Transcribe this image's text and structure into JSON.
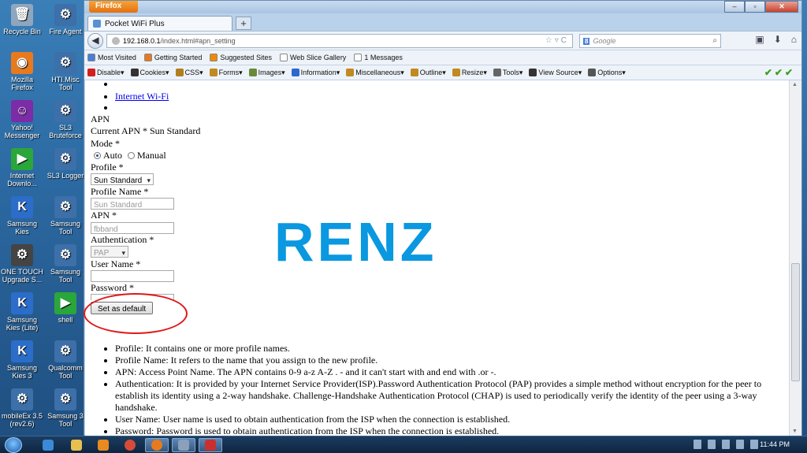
{
  "desktop": {
    "icons": [
      {
        "label": "Recycle Bin",
        "color": "#8fa6bf",
        "glyph": "🗑"
      },
      {
        "label": "Fire Agent",
        "color": "#3d6fa8",
        "glyph": "⚙"
      },
      {
        "label": "Mozilla Firefox",
        "color": "#e87a1e",
        "glyph": "◉"
      },
      {
        "label": "HTI.Misc Tool",
        "color": "#3d6fa8",
        "glyph": "⚙"
      },
      {
        "label": "Yahoo! Messenger",
        "color": "#7b2ca6",
        "glyph": "☺"
      },
      {
        "label": "SL3 Bruteforce",
        "color": "#3d6fa8",
        "glyph": "⚙"
      },
      {
        "label": "Internet Downlo...",
        "color": "#2aa63a",
        "glyph": "▶"
      },
      {
        "label": "SL3 Logger",
        "color": "#3d6fa8",
        "glyph": "⚙"
      },
      {
        "label": "Samsung Kies",
        "color": "#2b6dc8",
        "glyph": "K"
      },
      {
        "label": "Samsung Tool",
        "color": "#3d6fa8",
        "glyph": "⚙"
      },
      {
        "label": "ONE TOUCH Upgrade S...",
        "color": "#444",
        "glyph": "⚙"
      },
      {
        "label": "Samsung Tool",
        "color": "#3d6fa8",
        "glyph": "⚙"
      },
      {
        "label": "Samsung Kies (Lite)",
        "color": "#2b6dc8",
        "glyph": "K"
      },
      {
        "label": "shell",
        "color": "#2aa63a",
        "glyph": "▶"
      },
      {
        "label": "Samsung Kies 3",
        "color": "#2b6dc8",
        "glyph": "K"
      },
      {
        "label": "Qualcomm Tool",
        "color": "#3d6fa8",
        "glyph": "⚙"
      },
      {
        "label": "mobileEx 3.5 (rev2.6)",
        "color": "#3d6fa8",
        "glyph": "⚙"
      },
      {
        "label": "Samsung 3 Tool",
        "color": "#3d6fa8",
        "glyph": "⚙"
      }
    ]
  },
  "browser": {
    "app_button": "Firefox",
    "tab_title": "Pocket WiFi Plus",
    "new_tab": "+",
    "url_domain": "192.168.0.1",
    "url_path": "/index.html#apn_setting",
    "search_placeholder": "Google",
    "bookmarks": [
      {
        "label": "Most Visited",
        "color": "#4a7ed8"
      },
      {
        "label": "Getting Started",
        "color": "#e87a1e"
      },
      {
        "label": "Suggested Sites",
        "color": "#f08a00"
      },
      {
        "label": "Web Slice Gallery",
        "color": "#ffffff"
      },
      {
        "label": "1 Messages",
        "color": "#ffffff"
      }
    ],
    "devtools": [
      {
        "label": "Disable▾",
        "color": "#d02020"
      },
      {
        "label": "Cookies▾",
        "color": "#333"
      },
      {
        "label": "CSS▾",
        "color": "#b08020"
      },
      {
        "label": "Forms▾",
        "color": "#c08a20"
      },
      {
        "label": "Images▾",
        "color": "#6a8a3a"
      },
      {
        "label": "Information▾",
        "color": "#2a6ad0"
      },
      {
        "label": "Miscellaneous▾",
        "color": "#c08a20"
      },
      {
        "label": "Outline▾",
        "color": "#c08a20"
      },
      {
        "label": "Resize▾",
        "color": "#c08a20"
      },
      {
        "label": "Tools▾",
        "color": "#666"
      },
      {
        "label": "View Source▾",
        "color": "#333"
      },
      {
        "label": "Options▾",
        "color": "#555"
      }
    ]
  },
  "page": {
    "nav_link": "Internet Wi-Fi",
    "section_title": "APN",
    "current_apn": "Current APN * Sun Standard",
    "mode_label": "Mode *",
    "mode_auto": "Auto",
    "mode_manual": "Manual",
    "profile_label": "Profile *",
    "profile_value": "Sun Standard",
    "profile_name_label": "Profile Name *",
    "profile_name_value": "Sun Standard",
    "apn_label": "APN *",
    "apn_value": "fbband",
    "auth_label": "Authentication *",
    "auth_value": "PAP",
    "username_label": "User Name *",
    "password_label": "Password *",
    "set_default_button": "Set as default",
    "help": [
      "Profile: It contains one or more profile names.",
      "Profile Name: It refers to the name that you assign to the new profile.",
      "APN: Access Point Name. The APN contains 0-9 a-z A-Z . - and it can't start with and end with .or -.",
      "Authentication: It is provided by your Internet Service Provider(ISP).Password Authentication Protocol (PAP) provides a simple method without encryption for the peer to establish its identity using a 2-way handshake. Challenge-Handshake Authentication Protocol (CHAP) is used to periodically verify the identity of the peer using a 3-way handshake.",
      "User Name: User name is used to obtain authentication from the ISP when the connection is established.",
      "Password: Password is used to obtain authentication from the ISP when the connection is established."
    ],
    "watermark": "RENZ"
  },
  "taskbar": {
    "clock": "11:44 PM"
  }
}
